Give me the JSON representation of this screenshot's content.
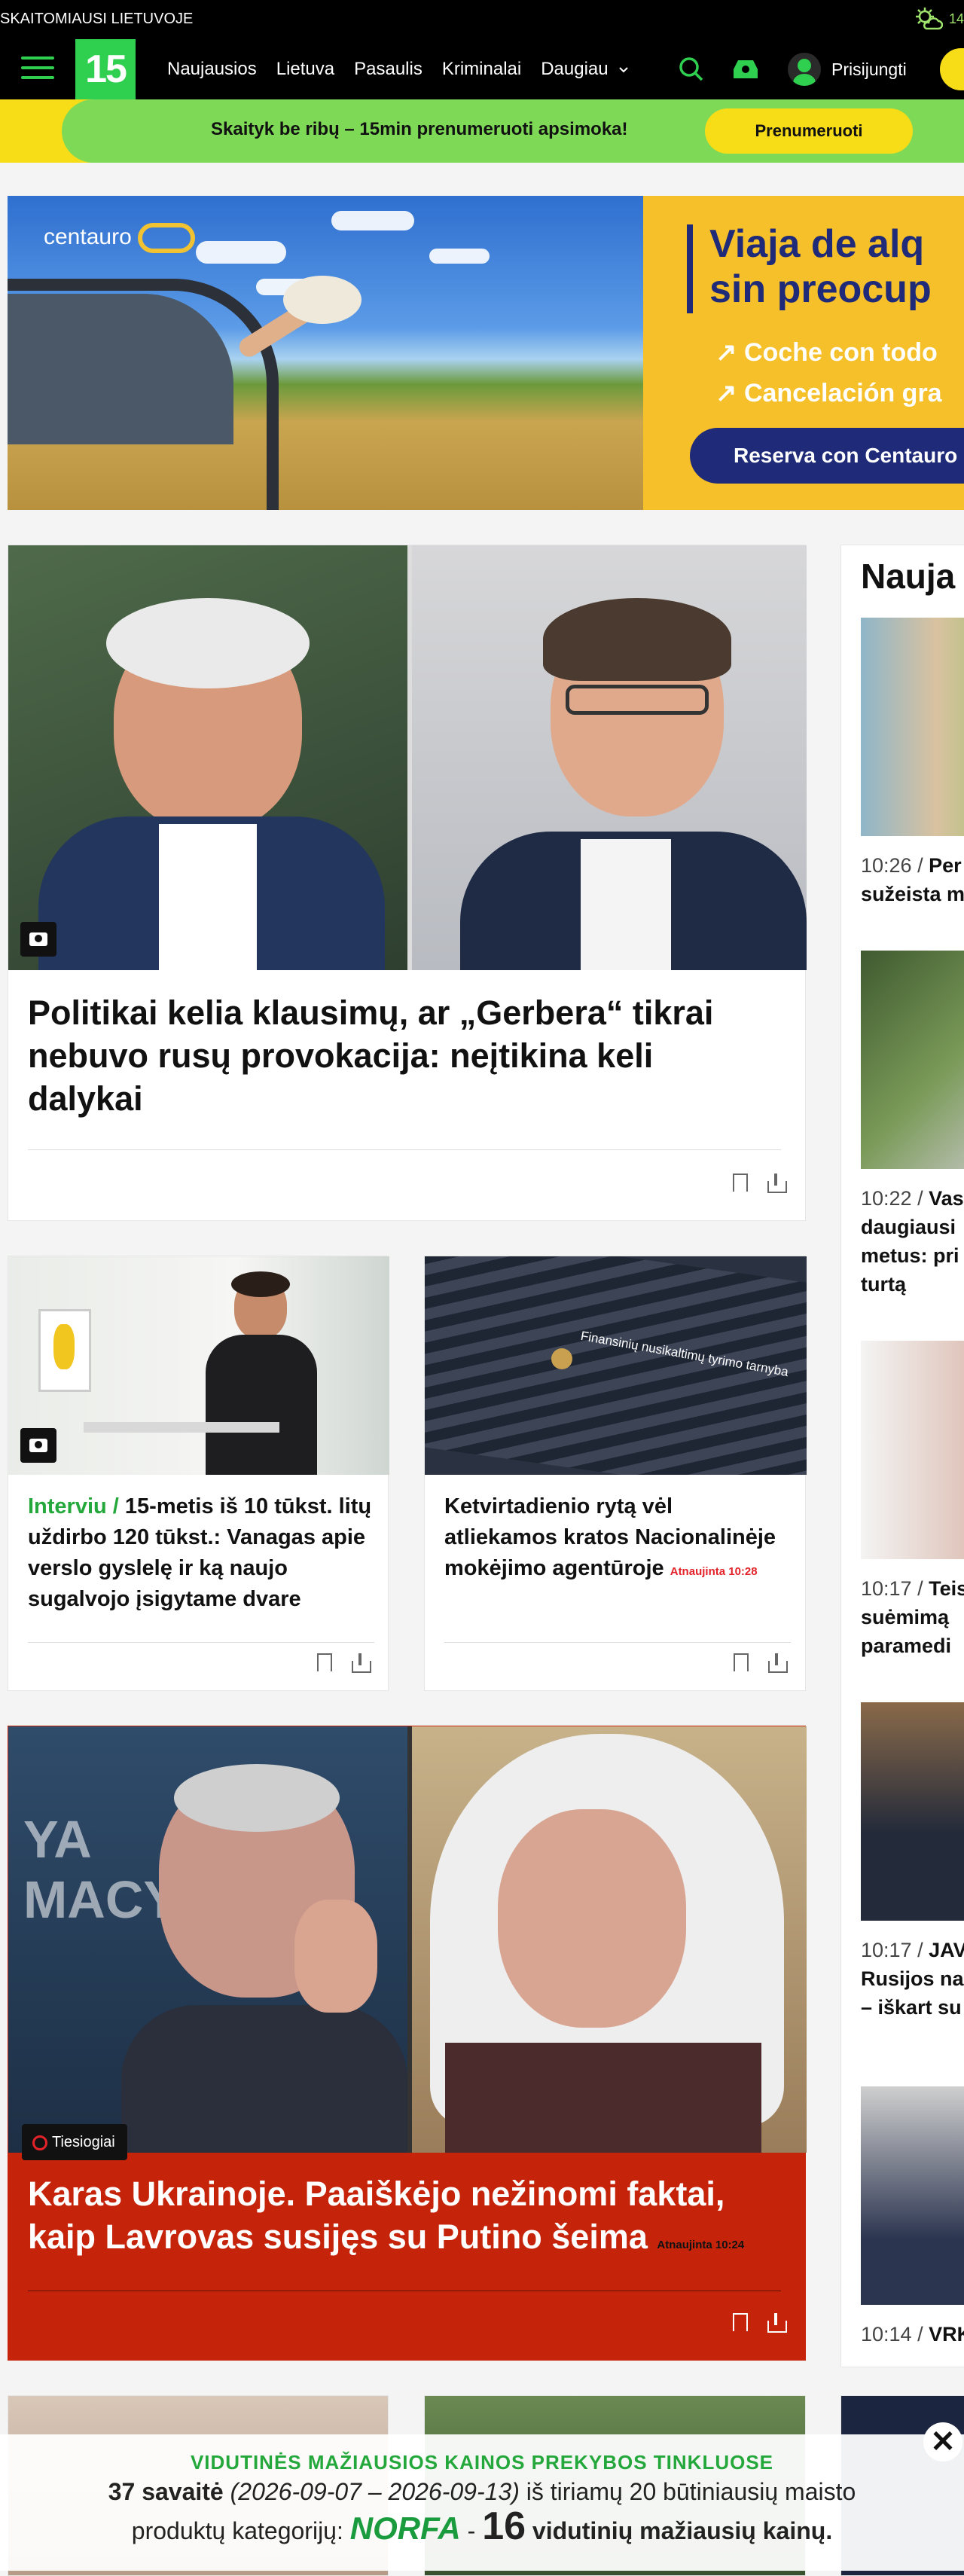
{
  "topstrip": {
    "brand": "SKAITOMIAUSI LIETUVOJE",
    "weather_temp": "14"
  },
  "nav": {
    "logo": "15",
    "links": [
      "Naujausios",
      "Lietuva",
      "Pasaulis",
      "Kriminalai",
      "Daugiau"
    ],
    "login": "Prisijungti"
  },
  "promo": {
    "text": "Skaityk be ribų – 15min prenumeruoti apsimoka!",
    "button": "Prenumeruoti"
  },
  "ad": {
    "brand": "centauro",
    "headline_1": "Viaja de alq",
    "headline_2": "sin preocup",
    "bullet_1": "Coche con todo",
    "bullet_2": "Cancelación gra",
    "cta": "Reserva con Centauro"
  },
  "articles": {
    "main": {
      "title": "Politikai kelia klausimų, ar „Gerbera“ tikrai nebuvo rusų provokacija: neįtikina keli dalykai"
    },
    "a2": {
      "kicker": "Interviu /",
      "title": "15-metis iš 10 tūkst. litų uždirbo 120 tūkst.: Vanagas apie verslo gyslelę ir ką naujo sugalvojo įsigytame dvare"
    },
    "a3": {
      "title": "Ketvirtadienio rytą vėl atliekamos kratos Nacionalinėje mokėjimo agentūroje",
      "updated": "Atnaujinta 10:28",
      "sign": "Finansinių nusikaltimų tyrimo tarnyba"
    },
    "a4": {
      "live": "Tiesiogiai",
      "title": "Karas Ukrainoje. Paaiškėjo nežinomi faktai, kaip Lavrovas susijęs su Putino šeima",
      "updated": "Atnaujinta 10:24"
    }
  },
  "sidebar": {
    "title": "Nauja",
    "items": [
      {
        "time": "10:26 /",
        "lines": [
          "Per l",
          "sužeista m"
        ]
      },
      {
        "time": "10:22 /",
        "lines": [
          "Vasa",
          "daugiausi",
          "metus: pri",
          "turtą"
        ]
      },
      {
        "time": "10:17 /",
        "lines": [
          "Teism",
          "suėmimą",
          "paramedi"
        ]
      },
      {
        "time": "10:17 /",
        "lines": [
          "JAV t",
          "Rusijos na",
          "– iškart su"
        ]
      },
      {
        "time": "10:14 /",
        "lines": [
          "VRK"
        ]
      }
    ]
  },
  "cookie": {
    "heading": "VIDUTINĖS MAŽIAUSIOS KAINOS PREKYBOS TINKLUOSE",
    "week": "37 savaitė",
    "range": "(2026-09-07 – 2026-09-13)",
    "rest1": "iš tiriamų 20 būtiniausių maisto",
    "rest2": "produktų kategorijų:",
    "brand": "NORFA",
    "dash": "-",
    "count": "16",
    "rest3": "vidutinių mažiausių kainų.",
    "close": "✕"
  },
  "colors": {
    "brand_green": "#2fcf4f",
    "promo_yellow": "#f7dc18",
    "live_red": "#c5240b"
  }
}
